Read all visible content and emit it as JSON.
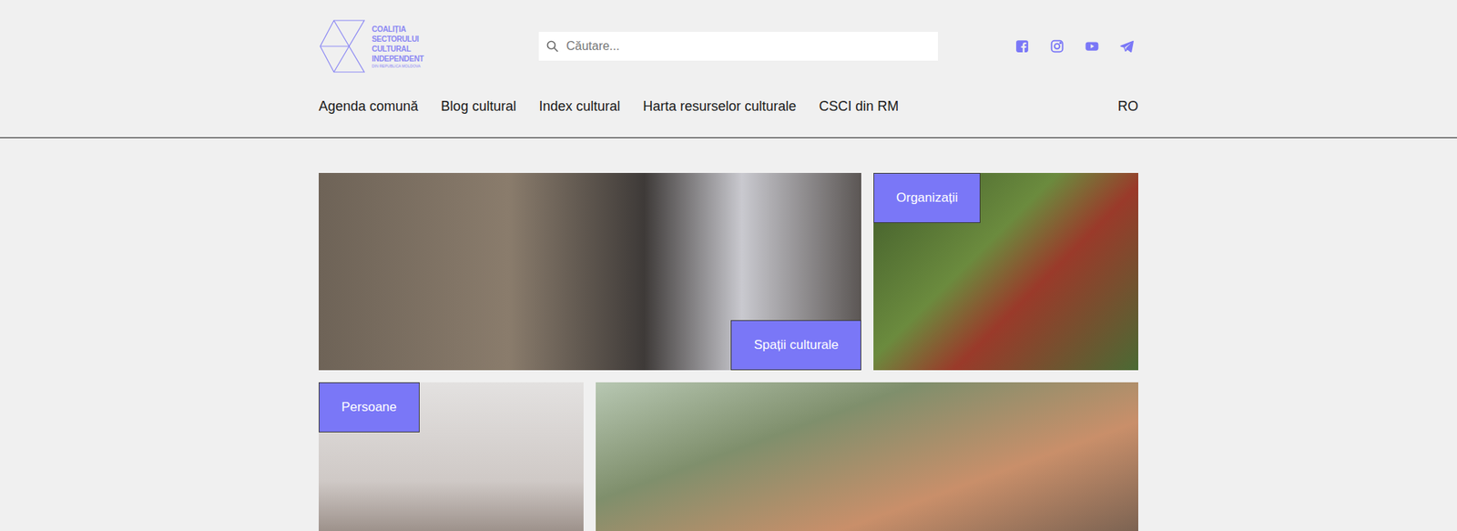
{
  "logo": {
    "lines": [
      "COALIȚIA",
      "SECTORULUI",
      "CULTURAL",
      "INDEPENDENT"
    ],
    "subtitle": "DIN REPUBLICA MOLDOVA"
  },
  "search": {
    "placeholder": "Căutare..."
  },
  "nav": {
    "items": [
      "Agenda comună",
      "Blog cultural",
      "Index cultural",
      "Harta resurselor culturale",
      "CSCI din RM"
    ],
    "language": "RO"
  },
  "tiles": [
    {
      "label": "Spații culturale"
    },
    {
      "label": "Organizații"
    },
    {
      "label": "Persoane"
    },
    {}
  ]
}
